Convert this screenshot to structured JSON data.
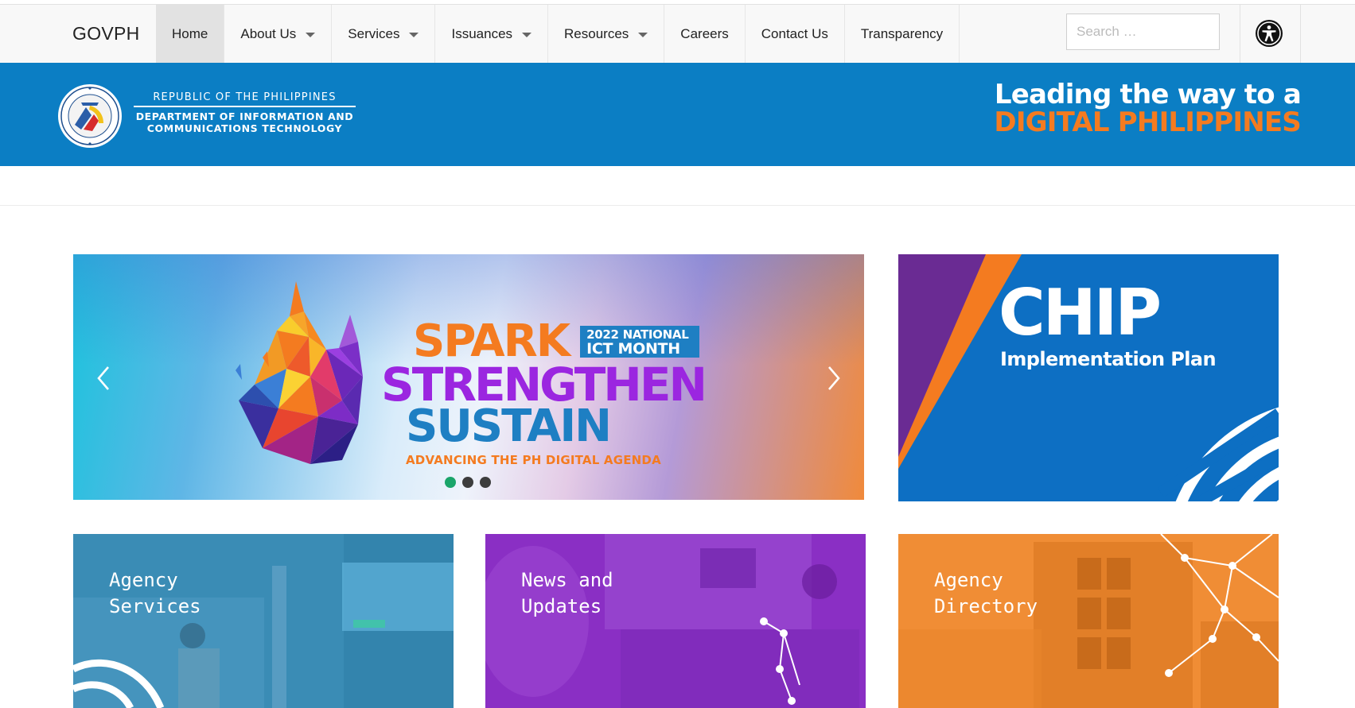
{
  "nav": {
    "brand": "GOVPH",
    "items": [
      {
        "label": "Home",
        "active": true,
        "dropdown": false
      },
      {
        "label": "About Us",
        "active": false,
        "dropdown": true
      },
      {
        "label": "Services",
        "active": false,
        "dropdown": true
      },
      {
        "label": "Issuances",
        "active": false,
        "dropdown": true
      },
      {
        "label": "Resources",
        "active": false,
        "dropdown": true
      },
      {
        "label": "Careers",
        "active": false,
        "dropdown": false
      },
      {
        "label": "Contact Us",
        "active": false,
        "dropdown": false
      },
      {
        "label": "Transparency",
        "active": false,
        "dropdown": false
      }
    ],
    "search_placeholder": "Search …",
    "accessibility_icon": "accessibility-icon"
  },
  "banner": {
    "agency_top": "REPUBLIC OF THE PHILIPPINES",
    "agency_line1": "DEPARTMENT OF INFORMATION AND",
    "agency_line2": "COMMUNICATIONS TECHNOLOGY",
    "tagline_line1": "Leading the way to a",
    "tagline_line2": "DIGITAL PHILIPPINES",
    "bg_color": "#0b7ec4",
    "accent_color": "#f47b20"
  },
  "hero": {
    "word1": "SPARK",
    "word2": "STRENGTHEN",
    "word3": "SUSTAIN",
    "box_line1": "2022 NATIONAL",
    "box_line2": "ICT MONTH",
    "subtitle": "ADVANCING THE PH DIGITAL AGENDA",
    "slide_count": 3,
    "active_slide": 1,
    "prev_icon": "chevron-left-icon",
    "next_icon": "chevron-right-icon"
  },
  "chip_card": {
    "title": "CHIP",
    "subtitle": "Implementation Plan"
  },
  "tiles": [
    {
      "label": "Agency\nServices",
      "color": "#3a8cb5"
    },
    {
      "label": "News and\nUpdates",
      "color": "#8a2fc4"
    },
    {
      "label": "Agency\nDirectory",
      "color": "#f08d35"
    }
  ]
}
